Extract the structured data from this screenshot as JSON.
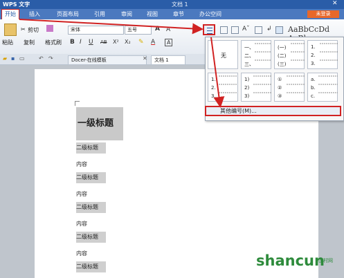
{
  "app": {
    "name": "WPS 文字",
    "doc_title": "文档 1",
    "close": "✕"
  },
  "menu": {
    "start": "开始",
    "items": [
      "插入",
      "页面布局",
      "引用",
      "审阅",
      "视图",
      "章节",
      "办公空间"
    ],
    "login": "未登录"
  },
  "ribbon": {
    "paste": "粘贴",
    "cut": "剪切",
    "copy": "复制",
    "format_painter": "格式刷",
    "font_name": "宋体",
    "font_size": "五号",
    "style_sample": "AaBbCcDd AaBb"
  },
  "tabs": {
    "docer": "Docer-在线模板",
    "doc": "文档 1"
  },
  "document": {
    "heading1": "一级标题",
    "heading2": "二级标题",
    "content": "内容"
  },
  "numbering_dropdown": {
    "none": "无",
    "styles": [
      [
        "一、",
        "二、",
        "三、"
      ],
      [
        "(一)",
        "(二)",
        "(三)"
      ],
      [
        "1.",
        "2.",
        "3."
      ],
      [
        "1.",
        "2.",
        "3."
      ],
      [
        "1)",
        "2)",
        "3)"
      ],
      [
        "①",
        "②",
        "③"
      ],
      [
        "a.",
        "b.",
        "c."
      ]
    ],
    "more": "其他编号(M)..."
  },
  "watermark": {
    "main": "shancun",
    "sub": "山村网"
  },
  "colors": {
    "title_bar": "#2a5da8",
    "menu_bar": "#4b79bf",
    "highlight": "#d12222",
    "login": "#e8682a"
  }
}
